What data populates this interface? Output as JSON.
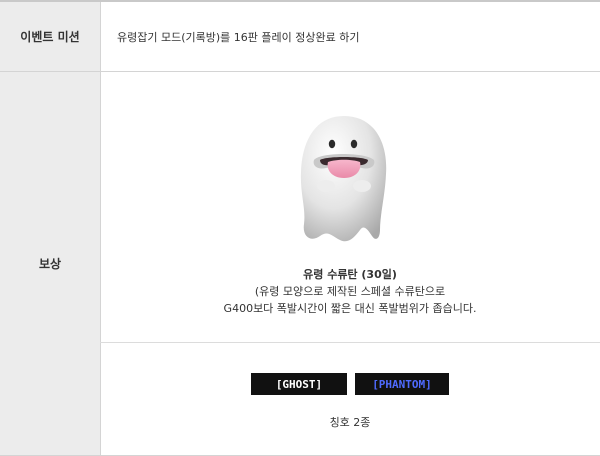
{
  "mission": {
    "header": "이벤트 미션",
    "text": "유령잡기 모드(기록방)를 16판 플레이 정상완료 하기"
  },
  "reward": {
    "header": "보상",
    "item_name": "유령 수류탄 (30일)",
    "item_desc_line1": "(유령 모양으로 제작된 스페셜 수류탄으로",
    "item_desc_line2": "G400보다 폭발시간이 짧은 대신 폭발범위가 좁습니다.",
    "titles": [
      {
        "label": "[GHOST]",
        "color": "#ffffff"
      },
      {
        "label": "[PHANTOM]",
        "color": "#4f6bff"
      }
    ],
    "titles_count": "칭호 2종"
  }
}
